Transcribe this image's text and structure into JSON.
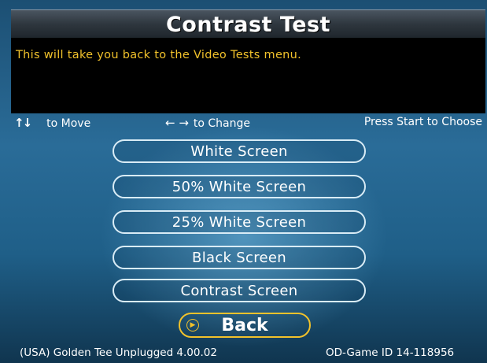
{
  "screen": {
    "title": "Contrast Test",
    "message": "This will take you back to the Video Tests menu."
  },
  "help": {
    "move_icon": "up-down-arrows-icon",
    "move_text": "to Move",
    "change_icon": "left-right-arrows-icon",
    "change_text": "to Change",
    "start_text": "Press Start to Choose"
  },
  "menu": {
    "items": [
      {
        "label": "White Screen"
      },
      {
        "label": "50% White Screen"
      },
      {
        "label": "25% White Screen"
      },
      {
        "label": "Black Screen"
      },
      {
        "label": "Contrast Screen"
      }
    ],
    "back_label": "Back",
    "selected": "Back"
  },
  "footer": {
    "version": "(USA) Golden Tee Unplugged 4.00.02",
    "game_id": "OD-Game ID 14-118956"
  },
  "colors": {
    "accent": "#f2c22b",
    "message_bg": "#000000",
    "background": "#2a6c98"
  }
}
